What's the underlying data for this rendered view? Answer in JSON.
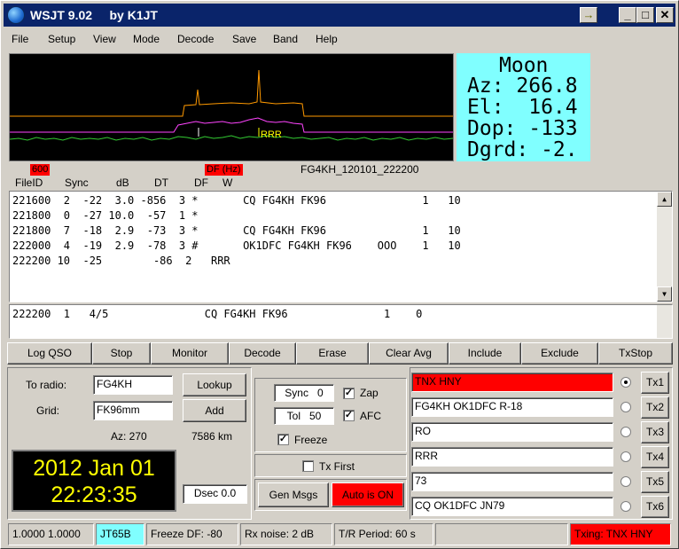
{
  "window": {
    "title": "WSJT 9.02     by K1JT",
    "arrow_glyph": "→",
    "min_glyph": "_",
    "max_glyph": "□",
    "close_glyph": "✕"
  },
  "menu": [
    "File",
    "Setup",
    "View",
    "Mode",
    "Decode",
    "Save",
    "Band",
    "Help"
  ],
  "waterfall": {
    "label": "RRR",
    "accent_orange": "#ff9900",
    "accent_magenta": "#ff44ff",
    "noise_green": "#33cc33"
  },
  "moon": {
    "title": "Moon",
    "az": "Az: 266.8",
    "el": "El:  16.4",
    "dop": "Dop: -133",
    "dgrd": "Dgrd: -2."
  },
  "tags": {
    "left": "600",
    "df": "DF (Hz)"
  },
  "filename": "FG4KH_120101_222200",
  "columns": [
    "FileID",
    "Sync",
    "dB",
    "DT",
    "DF",
    "W"
  ],
  "decodes": [
    "221600  2  -22  3.0 -856  3 *       CQ FG4KH FK96               1   10",
    "221800  0  -27 10.0  -57  1 *",
    "221800  7  -18  2.9  -73  3 *       CQ FG4KH FK96               1   10",
    "222000  4  -19  2.9  -78  3 #       OK1DFC FG4KH FK96    OOO    1   10",
    "222200 10  -25        -86  2   RRR"
  ],
  "average": "222200  1   4/5               CQ FG4KH FK96               1    0",
  "buttons": [
    "Log QSO",
    "Stop",
    "Monitor",
    "Decode",
    "Erase",
    "Clear Avg",
    "Include",
    "Exclude",
    "TxStop"
  ],
  "station": {
    "to_radio_label": "To radio:",
    "to_radio": "FG4KH",
    "grid_label": "Grid:",
    "grid": "FK96mm",
    "lookup": "Lookup",
    "add": "Add",
    "az": "Az: 270",
    "dist": "7586 km"
  },
  "clock": {
    "date": "2012 Jan 01",
    "time": "22:23:35"
  },
  "dsec": "Dsec  0.0",
  "controls": {
    "sync_label": "Sync",
    "sync_value": "0",
    "tol_label": "Tol",
    "tol_value": "50",
    "zap": "Zap",
    "afc": "AFC",
    "freeze": "Freeze",
    "tx_first": "Tx First",
    "gen_msgs": "Gen Msgs",
    "auto": "Auto is  ON"
  },
  "tx": [
    {
      "msg": "TNX HNY",
      "btn": "Tx1"
    },
    {
      "msg": "FG4KH OK1DFC R-18",
      "btn": "Tx2"
    },
    {
      "msg": "RO",
      "btn": "Tx3"
    },
    {
      "msg": "RRR",
      "btn": "Tx4"
    },
    {
      "msg": "73",
      "btn": "Tx5"
    },
    {
      "msg": "CQ OK1DFC JN79",
      "btn": "Tx6"
    }
  ],
  "status": {
    "freq": "1.0000 1.0000",
    "mode": "JT65B",
    "freeze": "Freeze DF: -80",
    "rxnoise": "Rx noise:  2 dB",
    "period": "T/R Period: 60 s",
    "txing": "Txing:  TNX HNY"
  },
  "colors": {
    "title_bg": "#0a246a",
    "red": "#ff0000",
    "cyan": "#80ffff",
    "clock_fg": "#ffff00"
  }
}
